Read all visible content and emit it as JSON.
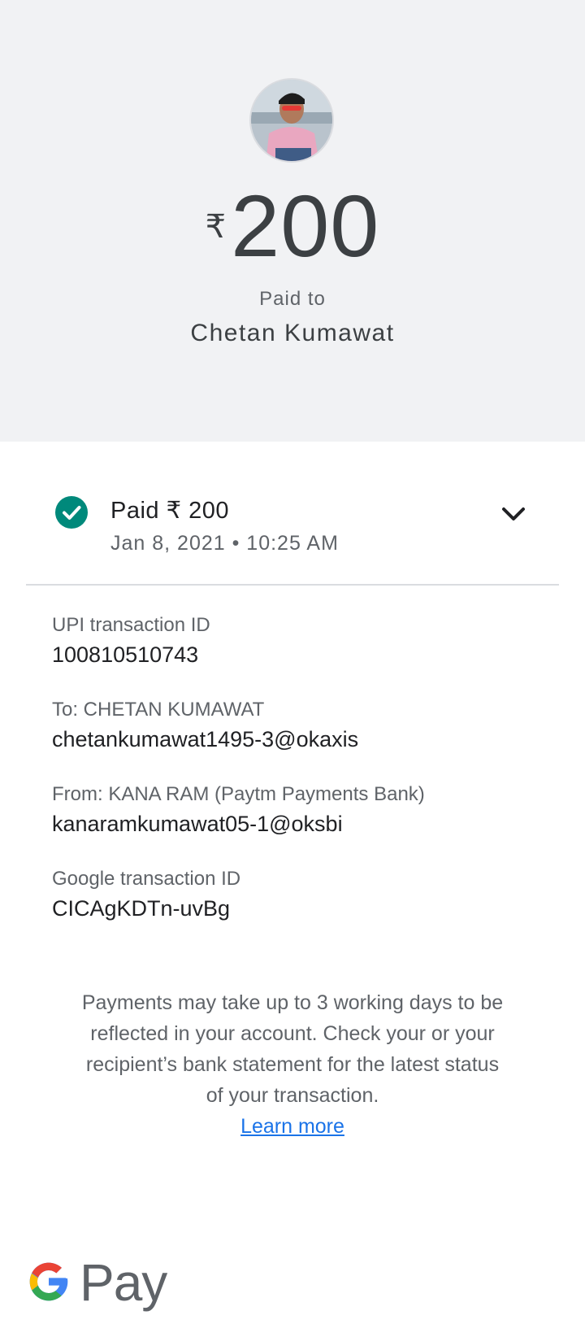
{
  "header": {
    "currency_symbol": "₹",
    "amount": "200",
    "paid_to_label": "Paid to",
    "payee_name": "Chetan Kumawat"
  },
  "status": {
    "title": "Paid ₹ 200",
    "date_time": "Jan 8, 2021 • 10:25 AM",
    "icon": "check-circle-icon",
    "color": "#00897b"
  },
  "details": [
    {
      "label": "UPI transaction ID",
      "value": "100810510743"
    },
    {
      "label": "To: CHETAN KUMAWAT",
      "value": "chetankumawat1495-3@okaxis"
    },
    {
      "label": "From: KANA RAM (Paytm Payments Bank)",
      "value": "kanaramkumawat05-1@oksbi"
    },
    {
      "label": "Google transaction ID",
      "value": "CICAgKDTn-uvBg"
    }
  ],
  "notice": {
    "text": "Payments may take up to 3 working days to be reflected in your account. Check your or your recipient’s bank statement for the latest status of your transaction.",
    "link_label": "Learn more",
    "link_color": "#1a73e8"
  },
  "footer": {
    "logo_text": "Pay"
  }
}
